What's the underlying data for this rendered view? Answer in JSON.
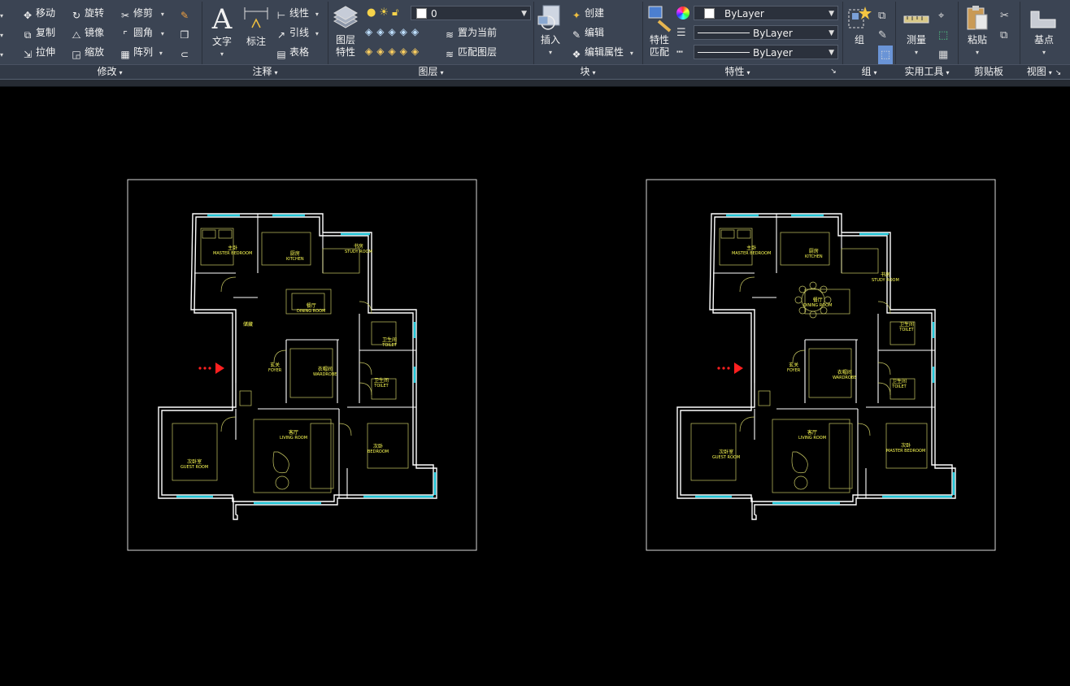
{
  "ribbon": {
    "modify": {
      "title": "修改",
      "move": "移动",
      "rotate": "旋转",
      "trim": "修剪",
      "copy": "复制",
      "mirror": "镜像",
      "fillet": "圆角",
      "stretch": "拉伸",
      "scale": "缩放",
      "array": "阵列"
    },
    "annotation": {
      "title": "注释",
      "text": "文字",
      "dimension": "标注",
      "linear": "线性",
      "leader": "引线",
      "table": "表格"
    },
    "layers": {
      "title": "图层",
      "layer_props_line1": "图层",
      "layer_props_line2": "特性",
      "current_layer": "0",
      "set_current": "置为当前",
      "match_layer": "匹配图层"
    },
    "block": {
      "title": "块",
      "insert": "插入",
      "create": "创建",
      "edit": "编辑",
      "edit_attr": "编辑属性"
    },
    "properties": {
      "title": "特性",
      "match_line1": "特性",
      "match_line2": "匹配",
      "color": "ByLayer",
      "lineweight": "ByLayer",
      "linetype": "ByLayer"
    },
    "groups": {
      "title": "组",
      "group": "组"
    },
    "utilities": {
      "title": "实用工具",
      "measure": "测量"
    },
    "clipboard": {
      "title": "剪贴板",
      "paste": "粘贴"
    },
    "view": {
      "title": "视图",
      "base": "基点"
    }
  },
  "plans": [
    {
      "rooms": {
        "master_bed": {
          "cn": "主卧",
          "en": "MASTER BEDROOM"
        },
        "kitchen": {
          "cn": "厨房",
          "en": "KITCHEN"
        },
        "study": {
          "cn": "书房",
          "en": "STUDY ROOM"
        },
        "dining": {
          "cn": "餐厅",
          "en": "DINING ROOM"
        },
        "bath1": {
          "cn": "卫生间",
          "en": "TOILET"
        },
        "foyer": {
          "cn": "玄关",
          "en": "FOYER"
        },
        "wardrobe": {
          "cn": "衣帽间",
          "en": "WARDROBE"
        },
        "bath2": {
          "cn": "卫生间",
          "en": "TOILET"
        },
        "living": {
          "cn": "客厅",
          "en": "LIVING ROOM"
        },
        "bed2": {
          "cn": "次卧",
          "en": "BEDROOM"
        },
        "kids": {
          "cn": "次卧室",
          "en": "GUEST ROOM"
        },
        "store": {
          "cn": "储藏",
          "en": ""
        }
      }
    },
    {
      "rooms": {
        "master_bed": {
          "cn": "主卧",
          "en": "MASTER BEDROOM"
        },
        "kitchen": {
          "cn": "厨房",
          "en": "KITCHEN"
        },
        "study": {
          "cn": "书房",
          "en": "STUDY ROOM"
        },
        "dining": {
          "cn": "餐厅",
          "en": "DINING ROOM"
        },
        "bath1": {
          "cn": "卫生间",
          "en": "TOILET"
        },
        "foyer": {
          "cn": "玄关",
          "en": "FOYER"
        },
        "wardrobe": {
          "cn": "衣帽间",
          "en": "WARDROBE"
        },
        "bath2": {
          "cn": "卫生间",
          "en": "TOILET"
        },
        "living": {
          "cn": "客厅",
          "en": "LIVING ROOM"
        },
        "bed2": {
          "cn": "次卧",
          "en": "MASTER BEDROOM"
        },
        "kids": {
          "cn": "次卧室",
          "en": "GUEST ROOM"
        }
      }
    }
  ],
  "colors": {
    "ribbon_bg": "#3b4453",
    "wall": "#ffffff",
    "furniture": "#c8c864",
    "window": "#21c7d9",
    "label": "#ffff55",
    "entry_arrow": "#ff2020"
  }
}
